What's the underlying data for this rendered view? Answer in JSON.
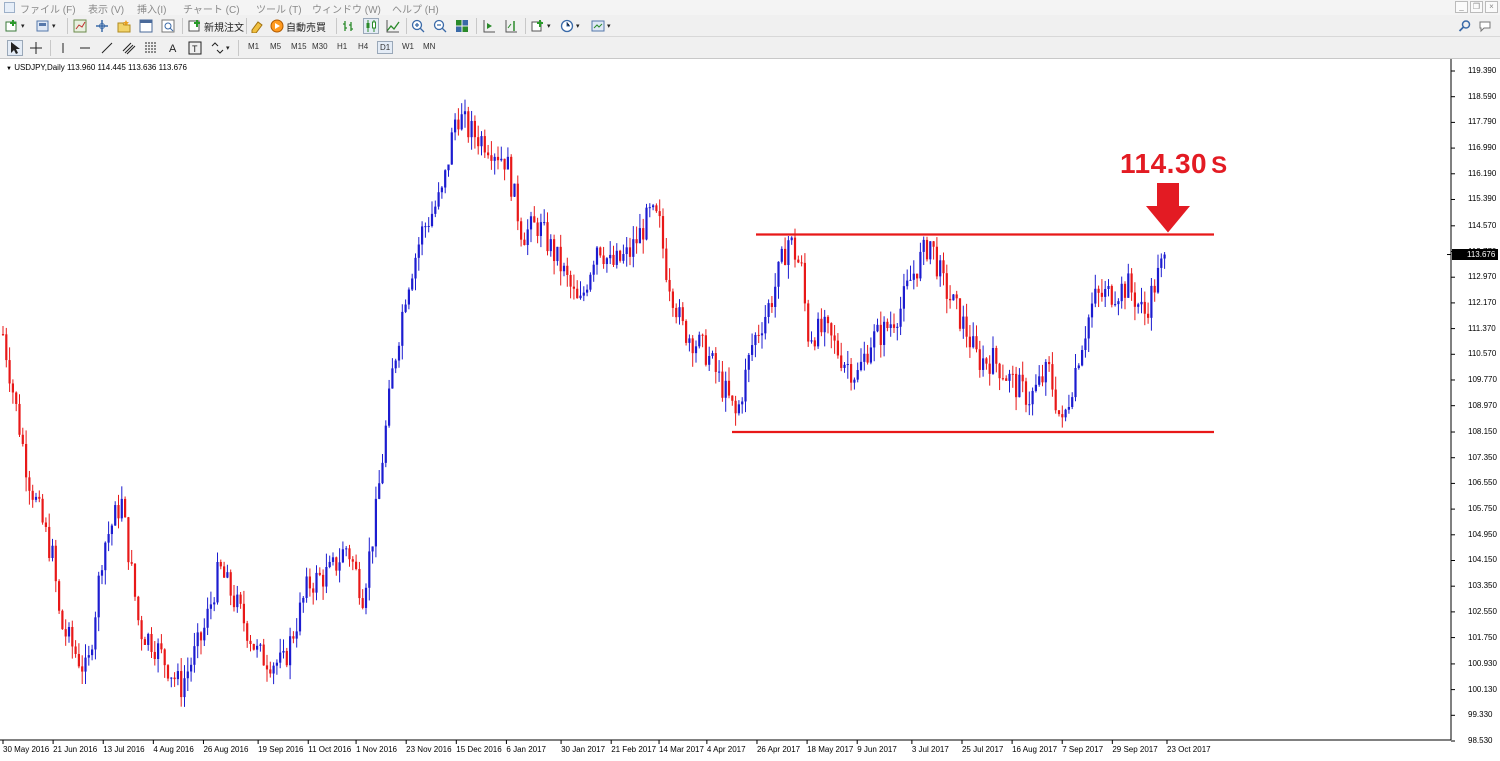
{
  "menubar": {
    "items": [
      "ファイル (F)",
      "表示 (V)",
      "挿入(I)",
      "チャート (C)",
      "ツール (T)",
      "ウィンドウ (W)",
      "ヘルプ (H)"
    ]
  },
  "toolbar": {
    "new_order_label": "新規注文",
    "auto_trade_label": "自動売買"
  },
  "timeframes": [
    "M1",
    "M5",
    "M15",
    "M30",
    "H1",
    "H4",
    "D1",
    "W1",
    "MN"
  ],
  "active_timeframe": "D1",
  "chart": {
    "header": "USDJPY,Daily  113.960 114.445 113.636 113.676",
    "current_price": "113.676",
    "annotation": {
      "value": "114.30",
      "suffix": "S",
      "color": "#e31b23"
    },
    "y_ticks": [
      "119.390",
      "118.590",
      "117.790",
      "116.990",
      "116.190",
      "115.390",
      "114.570",
      "113.770",
      "112.970",
      "112.170",
      "111.370",
      "110.570",
      "109.770",
      "108.970",
      "108.150",
      "107.350",
      "106.550",
      "105.750",
      "104.950",
      "104.150",
      "103.350",
      "102.550",
      "101.750",
      "100.930",
      "100.130",
      "99.330",
      "98.530"
    ],
    "x_ticks": [
      "30 May 2016",
      "21 Jun 2016",
      "13 Jul 2016",
      "4 Aug 2016",
      "26 Aug 2016",
      "19 Sep 2016",
      "11 Oct 2016",
      "1 Nov 2016",
      "23 Nov 2016",
      "15 Dec 2016",
      "6 Jan 2017",
      "30 Jan 2017",
      "21 Feb 2017",
      "14 Mar 2017",
      "4 Apr 2017",
      "26 Apr 2017",
      "18 May 2017",
      "9 Jun 2017",
      "3 Jul 2017",
      "25 Jul 2017",
      "16 Aug 2017",
      "7 Sep 2017",
      "29 Sep 2017",
      "23 Oct 2017"
    ],
    "resistance_level": 114.3,
    "support_level": 108.15,
    "bull_color": "#1c1cd0",
    "bear_color": "#e81818",
    "line_color": "#e81818"
  },
  "chart_data": {
    "type": "candlestick",
    "symbol": "USDJPY",
    "timeframe": "Daily",
    "ohlc_last": {
      "open": 113.96,
      "high": 114.445,
      "low": 113.636,
      "close": 113.676
    },
    "ylim": [
      98.53,
      119.39
    ],
    "x_range": [
      "30 May 2016",
      "23 Oct 2017"
    ],
    "horizontal_lines": [
      114.3,
      108.15
    ],
    "close_path": [
      [
        "30 May 2016",
        111.2
      ],
      [
        "10 Jun 2016",
        106.8
      ],
      [
        "21 Jun 2016",
        104.2
      ],
      [
        "24 Jun 2016",
        102.2
      ],
      [
        "6 Jul 2016",
        100.6
      ],
      [
        "13 Jul 2016",
        104.6
      ],
      [
        "21 Jul 2016",
        106.0
      ],
      [
        "29 Jul 2016",
        102.0
      ],
      [
        "4 Aug 2016",
        101.6
      ],
      [
        "16 Aug 2016",
        100.2
      ],
      [
        "26 Aug 2016",
        101.9
      ],
      [
        "2 Sep 2016",
        103.9
      ],
      [
        "12 Sep 2016",
        102.4
      ],
      [
        "19 Sep 2016",
        101.2
      ],
      [
        "30 Sep 2016",
        100.9
      ],
      [
        "11 Oct 2016",
        103.4
      ],
      [
        "21 Oct 2016",
        103.8
      ],
      [
        "28 Oct 2016",
        104.6
      ],
      [
        "4 Nov 2016",
        103.1
      ],
      [
        "9 Nov 2016",
        105.2
      ],
      [
        "17 Nov 2016",
        110.0
      ],
      [
        "23 Nov 2016",
        112.6
      ],
      [
        "30 Nov 2016",
        114.4
      ],
      [
        "9 Dec 2016",
        115.6
      ],
      [
        "15 Dec 2016",
        118.1
      ],
      [
        "21 Dec 2016",
        117.5
      ],
      [
        "28 Dec 2016",
        117.2
      ],
      [
        "6 Jan 2017",
        116.6
      ],
      [
        "13 Jan 2017",
        114.3
      ],
      [
        "20 Jan 2017",
        114.6
      ],
      [
        "30 Jan 2017",
        113.3
      ],
      [
        "7 Feb 2017",
        112.0
      ],
      [
        "15 Feb 2017",
        114.1
      ],
      [
        "21 Feb 2017",
        113.3
      ],
      [
        "1 Mar 2017",
        113.7
      ],
      [
        "10 Mar 2017",
        114.9
      ],
      [
        "14 Mar 2017",
        114.7
      ],
      [
        "17 Mar 2017",
        113.3
      ],
      [
        "24 Mar 2017",
        111.4
      ],
      [
        "4 Apr 2017",
        110.6
      ],
      [
        "12 Apr 2017",
        109.4
      ],
      [
        "17 Apr 2017",
        108.6
      ],
      [
        "24 Apr 2017",
        110.9
      ],
      [
        "2 May 2017",
        112.2
      ],
      [
        "10 May 2017",
        114.2
      ],
      [
        "16 May 2017",
        113.1
      ],
      [
        "18 May 2017",
        111.2
      ],
      [
        "26 May 2017",
        111.3
      ],
      [
        "2 Jun 2017",
        110.5
      ],
      [
        "9 Jun 2017",
        109.9
      ],
      [
        "15 Jun 2017",
        111.0
      ],
      [
        "21 Jun 2017",
        111.3
      ],
      [
        "28 Jun 2017",
        112.0
      ],
      [
        "3 Jul 2017",
        113.0
      ],
      [
        "11 Jul 2017",
        114.1
      ],
      [
        "17 Jul 2017",
        112.7
      ],
      [
        "25 Jul 2017",
        111.6
      ],
      [
        "1 Aug 2017",
        110.4
      ],
      [
        "8 Aug 2017",
        110.4
      ],
      [
        "16 Aug 2017",
        109.7
      ],
      [
        "24 Aug 2017",
        109.2
      ],
      [
        "1 Sep 2017",
        110.1
      ],
      [
        "7 Sep 2017",
        108.3
      ],
      [
        "15 Sep 2017",
        110.8
      ],
      [
        "21 Sep 2017",
        112.3
      ],
      [
        "29 Sep 2017",
        112.5
      ],
      [
        "6 Oct 2017",
        112.7
      ],
      [
        "13 Oct 2017",
        111.8
      ],
      [
        "20 Oct 2017",
        113.2
      ],
      [
        "23 Oct 2017",
        113.676
      ]
    ]
  }
}
